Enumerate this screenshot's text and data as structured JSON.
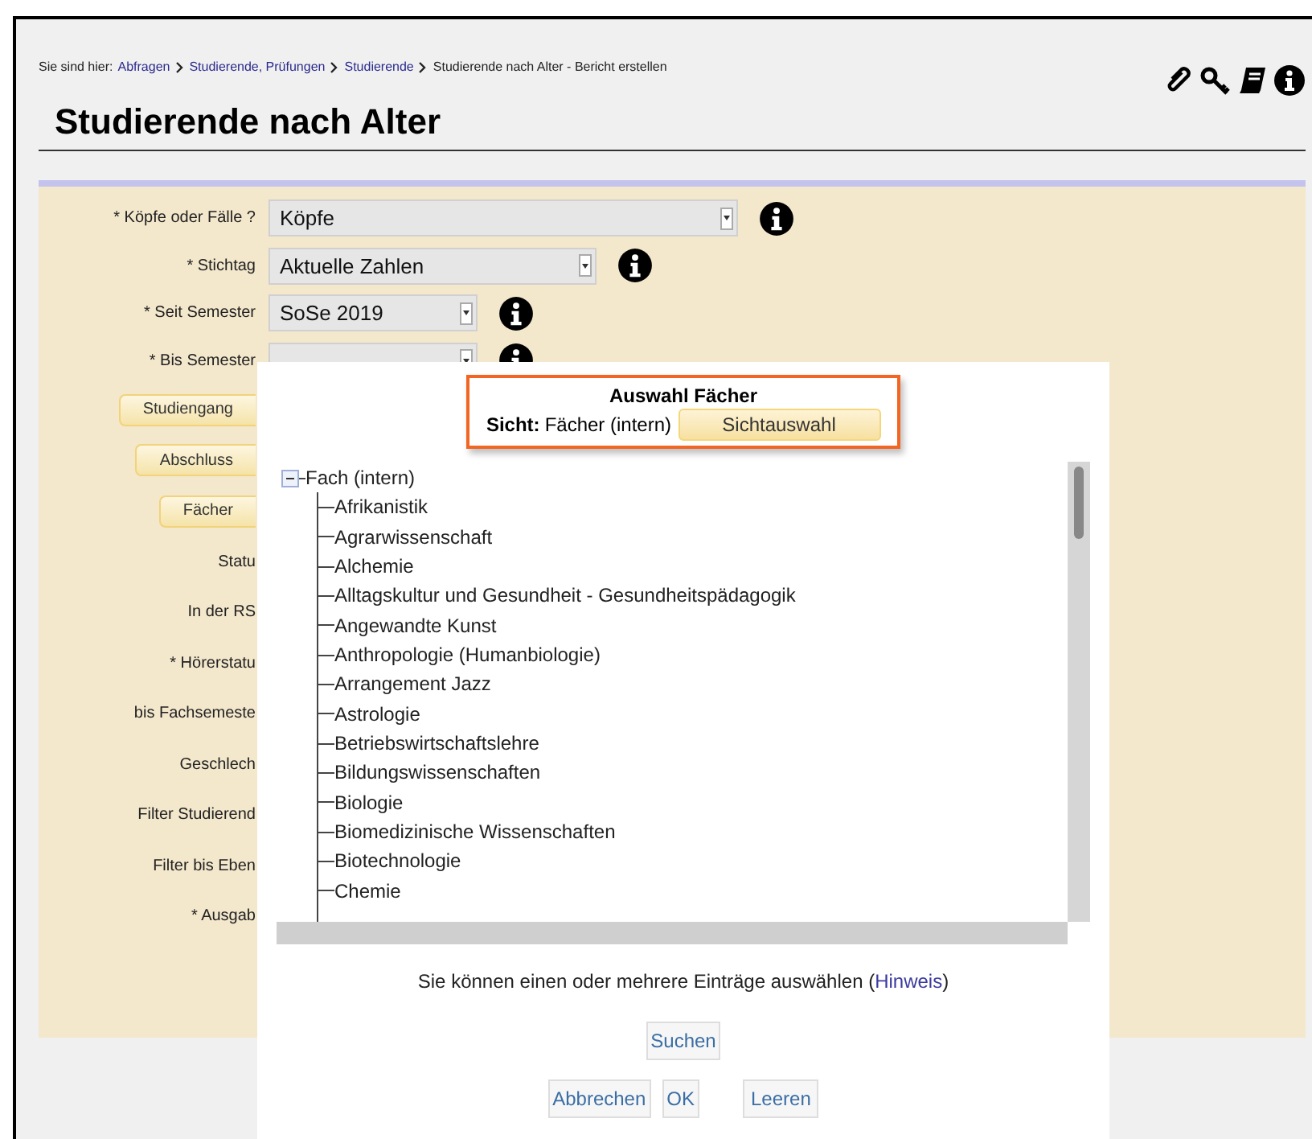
{
  "breadcrumb": {
    "label": "Sie sind hier:",
    "links": [
      "Abfragen",
      "Studierende, Prüfungen",
      "Studierende"
    ],
    "current": "Studierende nach Alter - Bericht erstellen"
  },
  "title": "Studierende nach Alter",
  "form_rows": [
    {
      "kind": "select",
      "label": "* Köpfe oder Fälle ?",
      "value": "Köpfe"
    },
    {
      "kind": "select",
      "label": "* Stichtag",
      "value": "Aktuelle Zahlen"
    },
    {
      "kind": "select",
      "label": "* Seit Semester",
      "value": "SoSe 2019"
    },
    {
      "kind": "select",
      "label": "* Bis Semester"
    },
    {
      "kind": "button",
      "label": "Studiengang"
    },
    {
      "kind": "button",
      "label": "Abschluss"
    },
    {
      "kind": "button",
      "label": "Fächer"
    },
    {
      "kind": "label",
      "label": "Statu"
    },
    {
      "kind": "label",
      "label": "In der RS"
    },
    {
      "kind": "label",
      "label": "* Hörerstatu"
    },
    {
      "kind": "label",
      "label": "bis Fachsemeste"
    },
    {
      "kind": "label",
      "label": "Geschlech"
    },
    {
      "kind": "label",
      "label": "Filter Studierend"
    },
    {
      "kind": "label",
      "label": "Filter bis Eben"
    },
    {
      "kind": "label",
      "label": "* Ausgab"
    }
  ],
  "dialog": {
    "title": "Auswahl Fächer",
    "view_label": "Sicht:",
    "view_value": "Fächer (intern)",
    "view_button": "Sichtauswahl",
    "tree": {
      "label": "Fach (intern)",
      "expanded": true,
      "children": [
        {
          "label": "Afrikanistik"
        },
        {
          "label": "Agrarwissenschaft"
        },
        {
          "label": "Alchemie"
        },
        {
          "label": "Alltagskultur und Gesundheit - Gesundheitspädagogik"
        },
        {
          "label": "Angewandte Kunst"
        },
        {
          "label": "Anthropologie (Humanbiologie)"
        },
        {
          "label": "Arrangement Jazz"
        },
        {
          "label": "Astrologie"
        },
        {
          "label": "Betriebswirtschaftslehre"
        },
        {
          "label": "Bildungswissenschaften"
        },
        {
          "label": "Biologie"
        },
        {
          "label": "Biomedizinische Wissenschaften"
        },
        {
          "label": "Biotechnologie"
        },
        {
          "label": "Chemie"
        }
      ]
    },
    "hint": "Sie können einen oder mehrere Einträge auswählen (",
    "hint_link": "Hinweis",
    "hint_end": ")",
    "search_button": "Suchen",
    "buttons": [
      "Abbrechen",
      "OK",
      "Leeren"
    ]
  }
}
